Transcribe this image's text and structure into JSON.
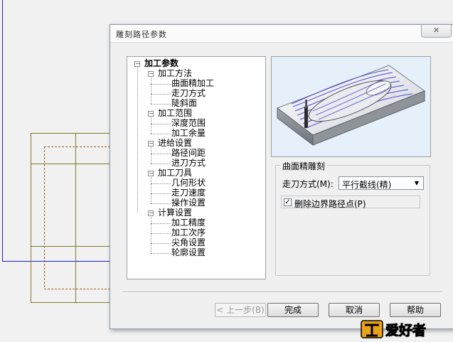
{
  "dialog": {
    "title": "雕刻路径参数",
    "close_glyph": "✕"
  },
  "tree": {
    "expander_glyph": "−",
    "root": {
      "label": "加工参数"
    },
    "groups": [
      {
        "label": "加工方法",
        "children": [
          "曲面精加工",
          "走刀方式",
          "陡斜面"
        ]
      },
      {
        "label": "加工范围",
        "children": [
          "深度范围",
          "加工余量"
        ]
      },
      {
        "label": "进给设置",
        "children": [
          "路径间距",
          "进刀方式"
        ]
      },
      {
        "label": "加工刀具",
        "children": [
          "几何形状",
          "走刀速度",
          "操作设置"
        ]
      },
      {
        "label": "计算设置",
        "children": [
          "加工精度",
          "加工次序",
          "尖角设置",
          "轮廓设置"
        ]
      }
    ]
  },
  "panel": {
    "group_title": "曲面精雕刻",
    "method_label": "走刀方式(M):",
    "method_value": "平行截线(精)",
    "dropdown_glyph": "▼",
    "delete_boundary_label": "删除边界路径点(P)",
    "delete_boundary_checked": true,
    "check_glyph": "✓"
  },
  "buttons": {
    "prev": "< 上一步(B)",
    "finish": "完成",
    "cancel": "取消",
    "help": "帮助"
  },
  "watermark": {
    "text": "爱好者"
  },
  "colors": {
    "background_grid": "#7d7a28",
    "background_line": "#1d1dc9",
    "preview_bg": "#e6f0fa",
    "model_lines": "#4a4ad0"
  }
}
